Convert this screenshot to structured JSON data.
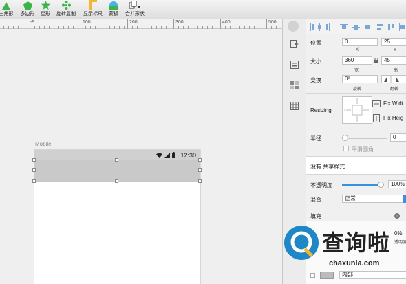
{
  "toolbar": {
    "items": [
      {
        "label": "三角形",
        "icon": "triangle-icon"
      },
      {
        "label": "多边形",
        "icon": "polygon-icon"
      },
      {
        "label": "星形",
        "icon": "star-icon"
      },
      {
        "label": "旋转复制",
        "icon": "rotate-copy-icon"
      },
      {
        "label": "显示标尺",
        "icon": "ruler-icon"
      },
      {
        "label": "蒙板",
        "icon": "mask-icon"
      },
      {
        "label": "合并形状",
        "icon": "combine-shape-icon"
      }
    ],
    "accent_green": "#3bb54a",
    "accent_yellow": "#f2b632"
  },
  "ruler": {
    "labels": [
      "-9",
      "100",
      "200",
      "300",
      "400",
      "500"
    ]
  },
  "canvas": {
    "artboard_name": "Mobile",
    "status_time": "12:30"
  },
  "inspector": {
    "position_label": "位置",
    "position_x": "0",
    "position_y": "25",
    "x_sub": "X",
    "y_sub": "Y",
    "size_label": "大小",
    "width": "360",
    "height": "45",
    "width_sub": "宽",
    "height_sub": "高",
    "transform_label": "变换",
    "rotation": "0º",
    "rotate_sub": "旋转",
    "flip_sub": "翻转",
    "resizing_label": "Resizing",
    "fix_width": "Fix Widt",
    "fix_height": "Fix Heig",
    "radius_label": "半径",
    "radius_value": "0",
    "smooth_corners": "平滑圆角",
    "shared_style": "没有 共享样式",
    "opacity_label": "不透明度",
    "opacity_value": "100%",
    "blend_label": "混合",
    "blend_value": "正常",
    "fill_label": "填充",
    "fill_percent": "0%",
    "fill_opacity_sub": "透明度",
    "border_position": "内部"
  },
  "watermark": {
    "brand": "查询啦",
    "domain": "chaxunla.com"
  }
}
